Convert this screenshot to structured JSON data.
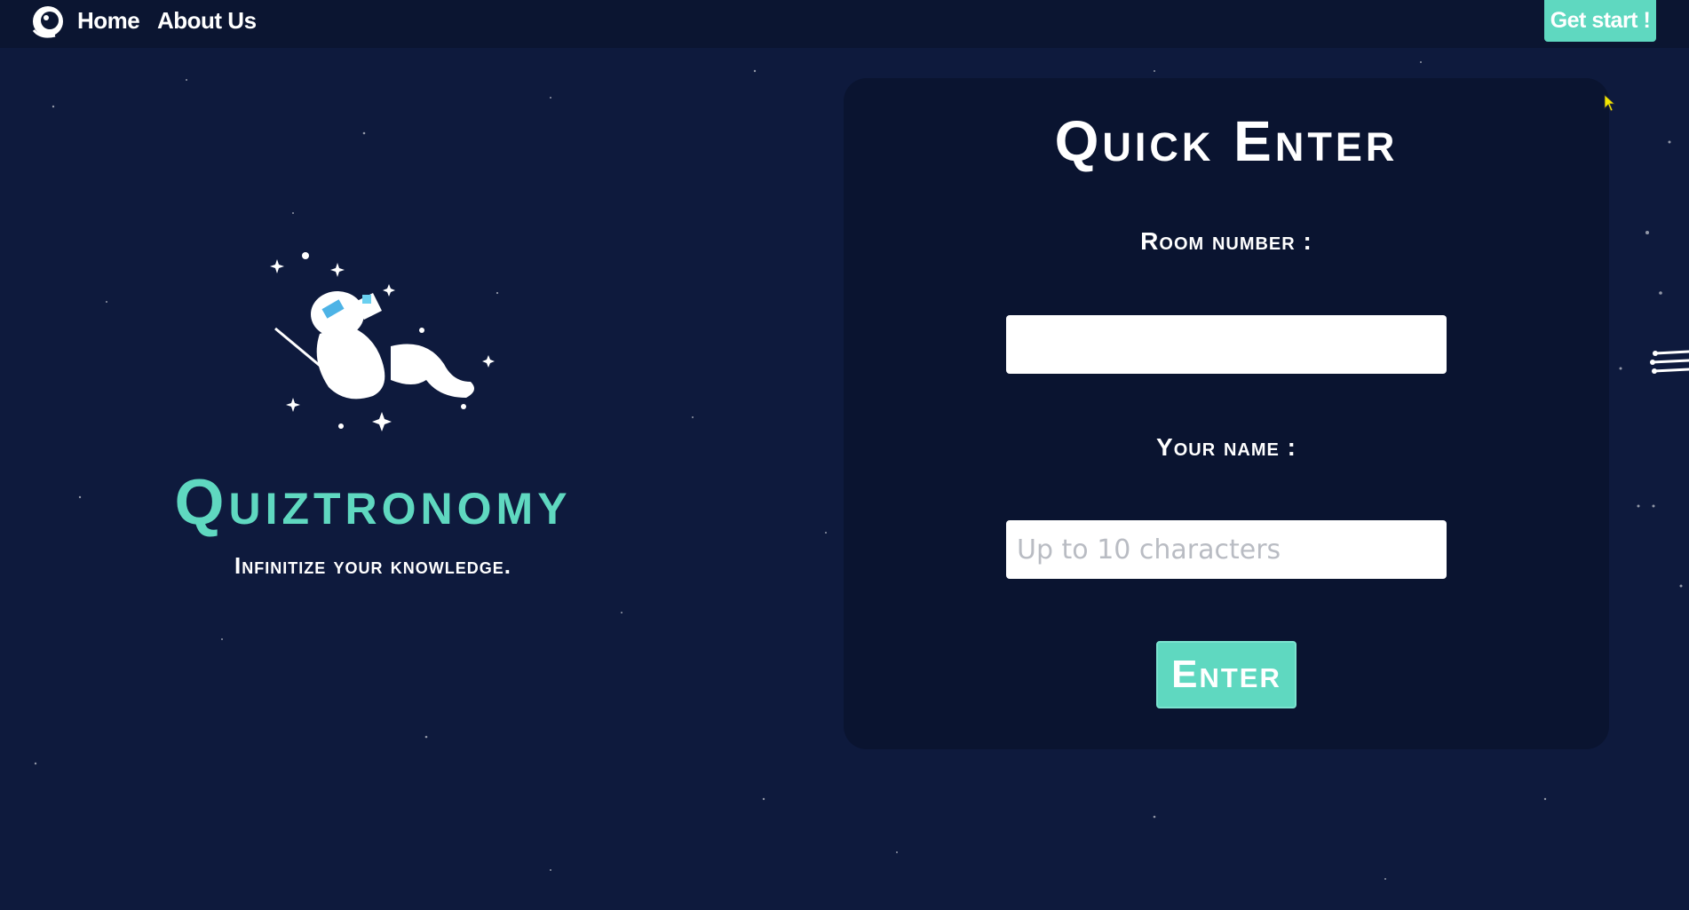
{
  "colors": {
    "background": "#0e1a3d",
    "navbar": "#0b1531",
    "panel": "#0a1430",
    "accent": "#5fd8c0",
    "text": "#ffffff",
    "placeholder": "#b9bcc3"
  },
  "nav": {
    "logo_icon": "astronaut-helmet-icon",
    "home_label": "Home",
    "about_label": "About Us",
    "cta_label": "Get start !"
  },
  "hero": {
    "illustration_icon": "floating-astronaut-icon",
    "brand_name": "Quiztronomy",
    "tagline": "Infinitize your knowledge."
  },
  "quick_enter": {
    "title": "Quick Enter",
    "room_label": "Room number :",
    "room_value": "",
    "room_placeholder": "",
    "name_label": "Your name :",
    "name_value": "",
    "name_placeholder": "Up to 10 characters",
    "submit_label": "Enter"
  },
  "decor": {
    "cursor_icon": "mouse-pointer-icon",
    "comet_icon": "shooting-star-icon"
  }
}
